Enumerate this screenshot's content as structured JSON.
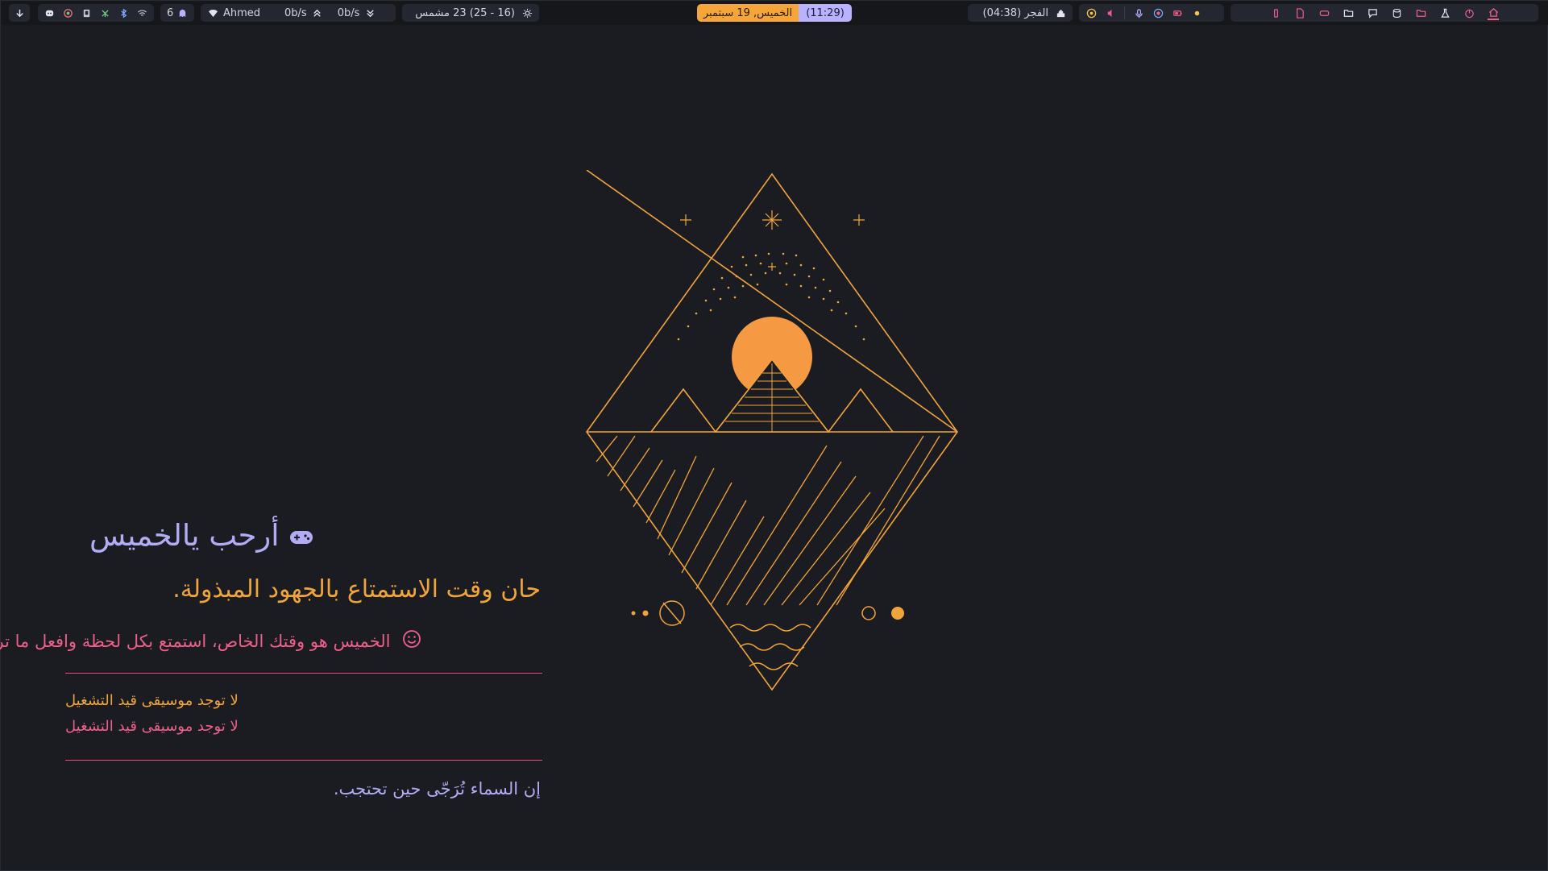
{
  "topbar": {
    "download_icon": "arrow-down-icon",
    "tray_icons": [
      "discord-icon",
      "browser-icon",
      "display-icon",
      "network-icon",
      "bluetooth-icon",
      "wifi-icon"
    ],
    "workspace_count": "6",
    "network": {
      "ssid": "Ahmed",
      "upload": "0b/s",
      "download": "0b/s"
    },
    "weather": "(16 - 25) 23 مشمس",
    "clock": {
      "time": "(11:29)",
      "date": "الخميس, 19 سبتمبر"
    },
    "prayer": "الفجر (04:38)",
    "accent": "#f5a53a",
    "accent2": "#b9b2ff"
  },
  "main": {
    "greeting": "أرحب يالخميس",
    "greeting_icon": "gamepad-icon",
    "subtitle": "حان وقت الاستمتاع بالجهود المبذولة.",
    "message": "الخميس هو وقتك الخاص، استمتع بكل لحظة وافعل ما تريد.",
    "message_icon": "smiley-icon",
    "music_line_1": "لا توجد موسيقى قيد التشغيل",
    "music_line_2": "لا توجد موسيقى قيد التشغيل",
    "quote": "إن السماء تُرَجّى حين تحتجب."
  },
  "colors": {
    "background": "#1a1c21",
    "lavender": "#b2acf5",
    "orange": "#f2a43c",
    "pink": "#f05f8a"
  }
}
